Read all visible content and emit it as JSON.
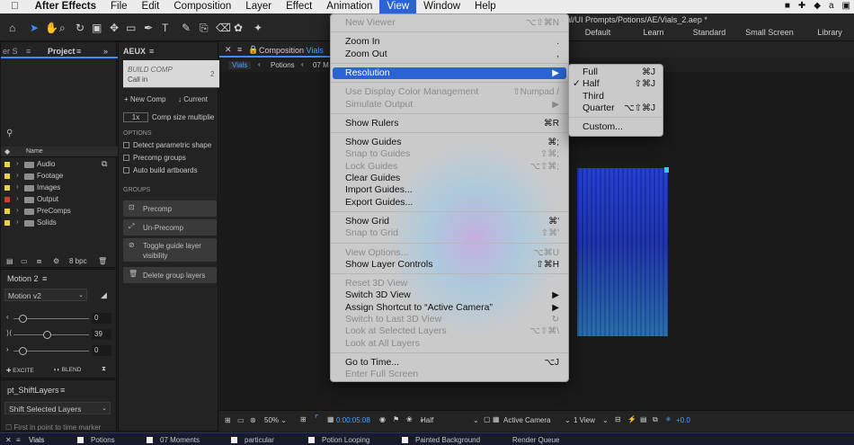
{
  "menubar": {
    "app": "After Effects",
    "items": [
      "File",
      "Edit",
      "Composition",
      "Layer",
      "Effect",
      "Animation",
      "View",
      "Window",
      "Help"
    ],
    "active": "View"
  },
  "toolbar": {
    "path": "al/UI Prompts/Potions/AE/Vials_2.aep *",
    "workspaces": [
      "Default",
      "Learn",
      "Standard",
      "Small Screen",
      "Library"
    ]
  },
  "left_panel": {
    "project_tab": "Project",
    "stub_tab": "er S",
    "column_name": "Name",
    "folders": [
      {
        "name": "Audio",
        "color": "#e8d33a"
      },
      {
        "name": "Footage",
        "color": "#e8d33a"
      },
      {
        "name": "Images",
        "color": "#e8d33a"
      },
      {
        "name": "Output",
        "color": "#d13c2c"
      },
      {
        "name": "PreComps",
        "color": "#e8d33a"
      },
      {
        "name": "Solids",
        "color": "#e8d33a"
      }
    ],
    "bpc": "8 bpc"
  },
  "motion_panel": {
    "title": "Motion 2",
    "preset": "Motion v2",
    "slider_values": [
      "0",
      "39",
      "0"
    ],
    "footer": [
      "EXCITE",
      "BLEND"
    ]
  },
  "shift_panel": {
    "title": "pt_ShiftLayers",
    "select": "Shift Selected Layers",
    "hint": "First in point to time marker"
  },
  "aeux": {
    "title": "AEUX",
    "build_label": "BUILD COMP",
    "build_sub": "Call in",
    "build_num": "2",
    "new_comp": "New Comp",
    "current": "Current",
    "mult": "1x",
    "mult_label": "Comp size multiplie",
    "options_header": "OPTIONS",
    "options": [
      "Detect parametric shape",
      "Precomp groups",
      "Auto build artboards"
    ],
    "groups_header": "GROUPS",
    "groups": [
      "Precomp",
      "Un-Precomp",
      "Toggle guide layer visibility",
      "Delete group layers"
    ]
  },
  "comp_panel": {
    "tab_prefix": "Composition",
    "tab_name": "Vials",
    "breadcrumbs": [
      "Vials",
      "Potions",
      "07 M"
    ],
    "zoom": "50%",
    "timecode": "0:00:05:08",
    "resolution": "Half",
    "camera": "Active Camera",
    "views": "1 View",
    "exposure": "+0.0"
  },
  "view_menu": [
    {
      "label": "New Viewer",
      "shortcut": "⌥⇧⌘N",
      "disabled": true
    },
    {
      "sep": true
    },
    {
      "label": "Zoom In",
      "shortcut": ".",
      "disabled": false
    },
    {
      "label": "Zoom Out",
      "shortcut": ",",
      "disabled": false
    },
    {
      "sep": true
    },
    {
      "label": "Resolution",
      "shortcut": "▶",
      "disabled": false,
      "highlight": true
    },
    {
      "sep": true
    },
    {
      "label": "Use Display Color Management",
      "shortcut": "⇧Numpad /",
      "disabled": true
    },
    {
      "label": "Simulate Output",
      "shortcut": "▶",
      "disabled": true
    },
    {
      "sep": true
    },
    {
      "label": "Show Rulers",
      "shortcut": "⌘R",
      "disabled": false
    },
    {
      "sep": true
    },
    {
      "label": "Show Guides",
      "shortcut": "⌘;",
      "disabled": false
    },
    {
      "label": "Snap to Guides",
      "shortcut": "⇧⌘;",
      "disabled": true
    },
    {
      "label": "Lock Guides",
      "shortcut": "⌥⇧⌘;",
      "disabled": true
    },
    {
      "label": "Clear Guides",
      "shortcut": "",
      "disabled": false
    },
    {
      "label": "Import Guides...",
      "shortcut": "",
      "disabled": false
    },
    {
      "label": "Export Guides...",
      "shortcut": "",
      "disabled": false
    },
    {
      "sep": true
    },
    {
      "label": "Show Grid",
      "shortcut": "⌘'",
      "disabled": false
    },
    {
      "label": "Snap to Grid",
      "shortcut": "⇧⌘'",
      "disabled": true
    },
    {
      "sep": true
    },
    {
      "label": "View Options...",
      "shortcut": "⌥⌘U",
      "disabled": true
    },
    {
      "label": "Show Layer Controls",
      "shortcut": "⇧⌘H",
      "disabled": false
    },
    {
      "sep": true
    },
    {
      "label": "Reset 3D View",
      "shortcut": "",
      "disabled": true
    },
    {
      "label": "Switch 3D View",
      "shortcut": "▶",
      "disabled": false
    },
    {
      "label": "Assign Shortcut to “Active Camera”",
      "shortcut": "▶",
      "disabled": false
    },
    {
      "label": "Switch to Last 3D View",
      "shortcut": "↻",
      "disabled": true
    },
    {
      "label": "Look at Selected Layers",
      "shortcut": "⌥⇧⌘\\",
      "disabled": true
    },
    {
      "label": "Look at All Layers",
      "shortcut": "",
      "disabled": true
    },
    {
      "sep": true
    },
    {
      "label": "Go to Time...",
      "shortcut": "⌥J",
      "disabled": false
    },
    {
      "label": "Enter Full Screen",
      "shortcut": "",
      "disabled": true
    }
  ],
  "resolution_menu": [
    {
      "label": "Full",
      "shortcut": "⌘J",
      "checked": false
    },
    {
      "label": "Half",
      "shortcut": "⇧⌘J",
      "checked": true
    },
    {
      "label": "Third",
      "shortcut": "",
      "checked": false
    },
    {
      "label": "Quarter",
      "shortcut": "⌥⇧⌘J",
      "checked": false
    },
    {
      "sep": true
    },
    {
      "label": "Custom...",
      "shortcut": "",
      "checked": false
    }
  ],
  "bottom_tabs": [
    "Vials",
    "Potions",
    "07 Moments",
    "particular",
    "Potion Looping",
    "Painted Background",
    "Render Queue"
  ],
  "colors": {
    "accent": "#2a63d3",
    "menu_bg": "#d6d6d6",
    "bottom_bar": "#181a2e",
    "canvas_blue": "#1b2fb0"
  }
}
